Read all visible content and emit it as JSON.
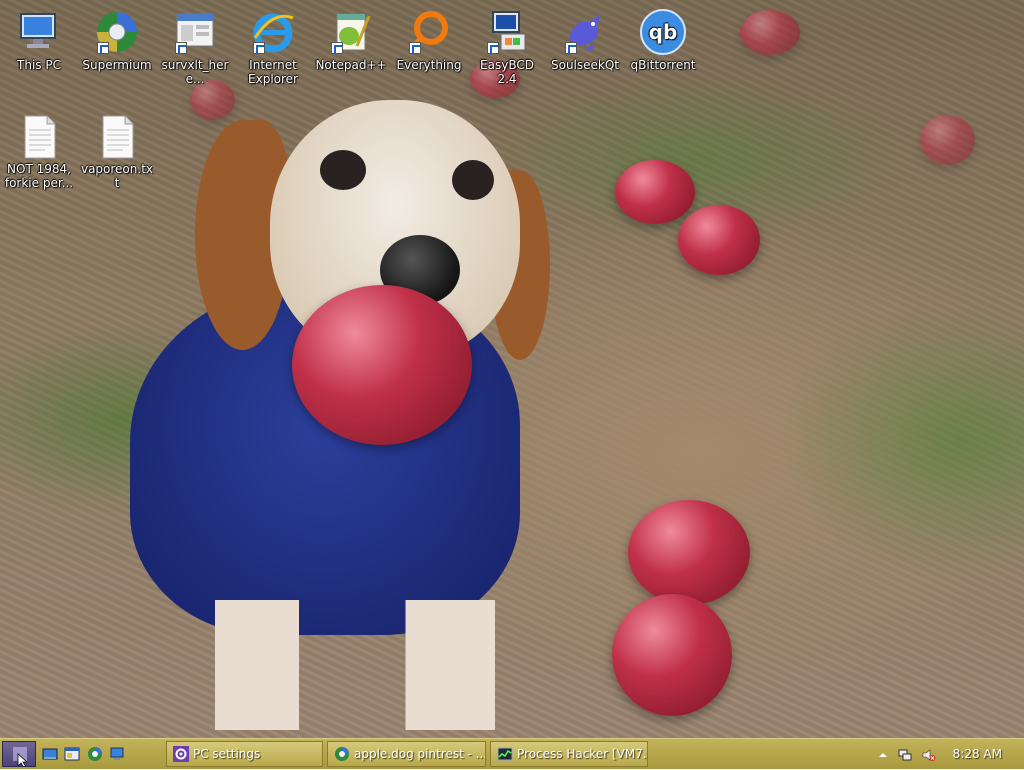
{
  "desktop": {
    "icons": [
      {
        "label": "This PC",
        "icon": "computer-icon"
      },
      {
        "label": "Supermium",
        "icon": "supermium-icon"
      },
      {
        "label": "survxlt_here...",
        "icon": "window-file-icon"
      },
      {
        "label": "Internet Explorer",
        "icon": "internet-explorer-icon"
      },
      {
        "label": "Notepad++",
        "icon": "notepadpp-icon"
      },
      {
        "label": "Everything",
        "icon": "everything-search-icon"
      },
      {
        "label": "EasyBCD 2.4",
        "icon": "easybcd-icon"
      },
      {
        "label": "SoulseekQt",
        "icon": "soulseek-bird-icon"
      },
      {
        "label": "qBittorrent",
        "icon": "qbittorrent-icon"
      },
      {
        "label": "NOT 1984, forkie per...",
        "icon": "text-file-icon"
      },
      {
        "label": "vaporeon.txt",
        "icon": "text-file-icon"
      }
    ]
  },
  "taskbar": {
    "start_icon": "start-button-icon",
    "quick_launch": [
      "show-desktop-icon",
      "explorer-icon",
      "supermium-icon",
      "computer-icon"
    ],
    "buttons": [
      {
        "label": "PC settings",
        "icon": "gear-icon"
      },
      {
        "label": "apple.dog pintrest - ...",
        "icon": "browser-icon"
      },
      {
        "label": "Process Hacker [VM7...",
        "icon": "process-hacker-icon"
      }
    ],
    "tray_icons": [
      "show-hidden-icons-arrow",
      "network-icon",
      "volume-muted-icon"
    ],
    "clock": "8:28 AM"
  },
  "colors": {
    "taskbar": "#b3a34a",
    "start_button": "#5a5186"
  }
}
